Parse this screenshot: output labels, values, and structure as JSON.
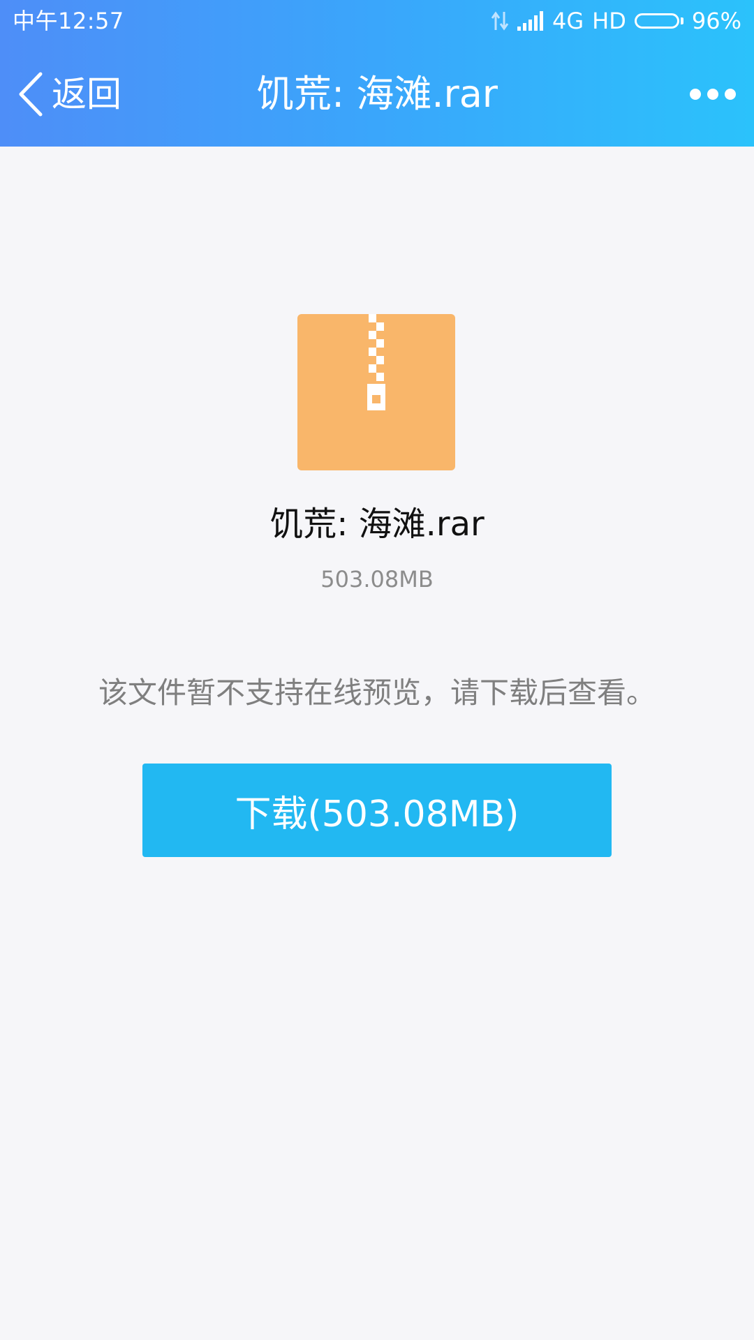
{
  "status_bar": {
    "time": "中午12:57",
    "network": "4G",
    "hd": "HD",
    "battery": "96%",
    "icons": [
      "data-transfer-icon",
      "signal-icon",
      "battery-icon"
    ]
  },
  "nav": {
    "back_label": "返回",
    "title": "饥荒: 海滩.rar",
    "back_icon": "chevron-left-icon",
    "more_icon": "more-icon"
  },
  "file": {
    "icon": "zip-archive-icon",
    "name": "饥荒: 海滩.rar",
    "size": "503.08MB"
  },
  "notice": "该文件暂不支持在线预览，请下载后查看。",
  "download_button": "下载(503.08MB)",
  "colors": {
    "header_gradient_start": "#4e8ef8",
    "header_gradient_end": "#2bc2fb",
    "background": "#f6f6f9",
    "file_icon": "#f9b66a",
    "download_button": "#22b8f2"
  }
}
